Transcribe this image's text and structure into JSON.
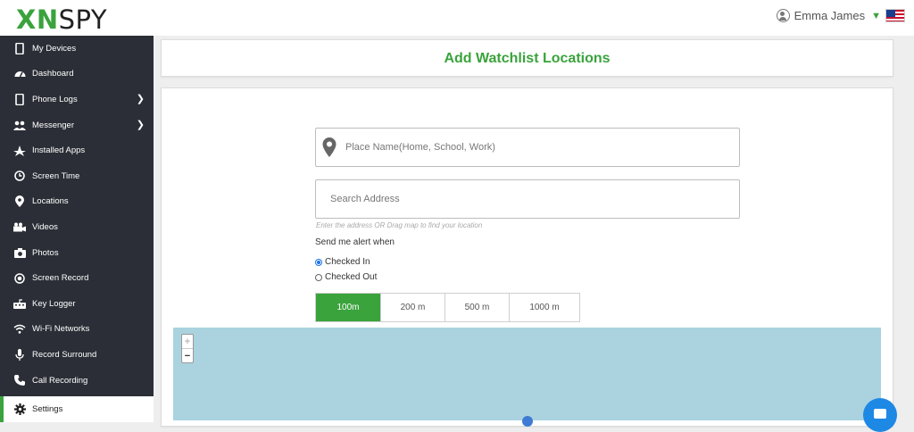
{
  "header": {
    "logo_accent": "XN",
    "logo_rest": "SPY",
    "user_name": "Emma James"
  },
  "sidebar": {
    "items": [
      {
        "label": "My Devices",
        "icon": "phone-icon"
      },
      {
        "label": "Dashboard",
        "icon": "dashboard-icon"
      },
      {
        "label": "Phone Logs",
        "icon": "phone-icon",
        "has_submenu": true
      },
      {
        "label": "Messenger",
        "icon": "people-icon",
        "has_submenu": true
      },
      {
        "label": "Installed Apps",
        "icon": "apps-icon"
      },
      {
        "label": "Screen Time",
        "icon": "clock-icon"
      },
      {
        "label": "Locations",
        "icon": "pin-icon"
      },
      {
        "label": "Videos",
        "icon": "video-icon"
      },
      {
        "label": "Photos",
        "icon": "camera-icon"
      },
      {
        "label": "Screen Record",
        "icon": "record-icon"
      },
      {
        "label": "Key Logger",
        "icon": "keyboard-icon"
      },
      {
        "label": "Wi-Fi Networks",
        "icon": "wifi-icon"
      },
      {
        "label": "Record Surround",
        "icon": "mic-icon"
      },
      {
        "label": "Call Recording",
        "icon": "call-icon"
      },
      {
        "label": "Settings",
        "icon": "gear-icon",
        "active": true
      }
    ]
  },
  "page": {
    "title": "Add Watchlist Locations"
  },
  "form": {
    "place_placeholder": "Place Name(Home, School, Work)",
    "search_placeholder": "Search Address",
    "hint": "Enter the address OR Drag map to find your location",
    "alert_label": "Send me alert when",
    "radio_options": [
      {
        "label": "Checked In",
        "checked": true
      },
      {
        "label": "Checked Out",
        "checked": false
      }
    ],
    "radius_options": [
      "100m",
      "200 m",
      "500 m",
      "1000 m"
    ],
    "selected_radius": "100m"
  },
  "map": {
    "zoom_in": "+",
    "zoom_out": "−"
  },
  "colors": {
    "brand_green": "#3aa33c",
    "sidebar_bg": "#2b2e36",
    "map_water": "#aad3df",
    "chat_blue": "#1e88e5"
  }
}
